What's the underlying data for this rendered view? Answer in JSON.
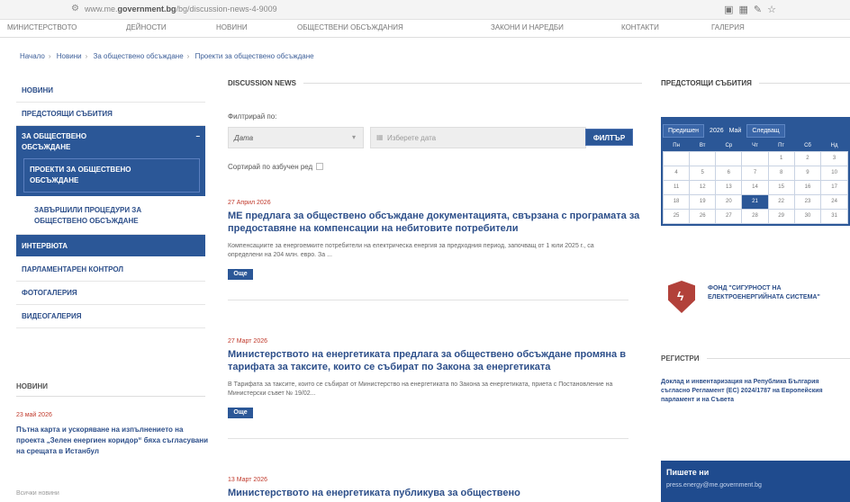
{
  "browser": {
    "url_prefix": "www.me.",
    "url_domain": "government.bg",
    "url_path": "/bg/discussion-news-4-9009"
  },
  "topnav": [
    "МИНИСТЕРСТВОТО",
    "ДЕЙНОСТИ",
    "НОВИНИ",
    "ОБЩЕСТВЕНИ ОБСЪЖДАНИЯ",
    "ЗАКОНИ И НАРЕДБИ",
    "КОНТАКТИ",
    "ГАЛЕРИЯ"
  ],
  "breadcrumbs": [
    "Начало",
    "Новини",
    "За обществено обсъждане",
    "Проекти за обществено обсъждане"
  ],
  "sidebar": {
    "items": [
      "НОВИНИ",
      "ПРЕДСТОЯЩИ СЪБИТИЯ"
    ],
    "open_section": {
      "line1": "ЗА ОБЩЕСТВЕНО",
      "line2": "ОБСЪЖДАНЕ",
      "toggle": "−"
    },
    "sub_active": {
      "line1": "ПРОЕКТИ ЗА ОБЩЕСТВЕНО",
      "line2": "ОБСЪЖДАНЕ"
    },
    "sub_item": {
      "line1": "ЗАВЪРШИЛИ ПРОЦЕДУРИ ЗА",
      "line2": "ОБЩЕСТВЕНО ОБСЪЖДАНЕ"
    },
    "after": [
      "ИНТЕРВЮТА",
      "ПАРЛАМЕНТАРЕН КОНТРОЛ",
      "ФОТОГАЛЕРИЯ",
      "ВИДЕОГАЛЕРИЯ"
    ],
    "news_heading": "НОВИНИ",
    "news_date": "23 май 2026",
    "news_title": "Пътна карта и ускоряване на изпълнението на проекта „Зелен енергиен коридор“ бяха съгласувани на срещата в Истанбул",
    "news_footer": "Всички новини"
  },
  "main": {
    "heading": "DISCUSSION NEWS",
    "filter_label": "Филтрирай по:",
    "select_value": "Дата",
    "date_placeholder": "Изберете дата",
    "filter_button": "ФИЛТЪР",
    "sort_label": "Сортирай по азбучен ред",
    "more_label": "Още",
    "articles": [
      {
        "date": "27 Април 2026",
        "title": "МЕ предлага за обществено обсъждане документацията, свързана с програмата за предоставяне на компенсации на небитовите потребители",
        "excerpt": "Компенсациите за енергоемките потребители на електрическа енергия за предходния период, започващ от 1 юли 2025 г., са определени на 204 млн. евро. За ..."
      },
      {
        "date": "27 Март 2026",
        "title": "Министерството на енергетиката предлага за обществено обсъждане промяна в тарифата за таксите, които се събират по Закона за енергетиката",
        "excerpt": "В Тарифата за таксите, които се събират от Министерство на енергетиката по Закона за енергетиката, приета с Постановление на Министерски съвет № 19/02..."
      },
      {
        "date": "13 Март 2026",
        "title": "Министерството на енергетиката публикува за обществено",
        "excerpt": ""
      }
    ]
  },
  "right": {
    "events_heading": "ПРЕДСТОЯЩИ СЪБИТИЯ",
    "calendar": {
      "prev": "Предишен",
      "year": "2026",
      "month": "Май",
      "next": "Следващ",
      "weekdays": [
        "Пн",
        "Вт",
        "Ср",
        "Чт",
        "Пт",
        "Сб",
        "Нд"
      ],
      "weeks": [
        [
          "",
          "",
          "",
          "",
          "1",
          "2",
          "3"
        ],
        [
          "4",
          "5",
          "6",
          "7",
          "8",
          "9",
          "10"
        ],
        [
          "11",
          "12",
          "13",
          "14",
          "15",
          "16",
          "17"
        ],
        [
          "18",
          "19",
          "20",
          "21",
          "22",
          "23",
          "24"
        ],
        [
          "25",
          "26",
          "27",
          "28",
          "29",
          "30",
          "31"
        ]
      ],
      "today": "21"
    },
    "fund_text": "ФОНД \"СИГУРНОСТ НА ЕЛЕКТРОЕНЕРГИЙНАТА СИСТЕМА\"",
    "registers_heading": "РЕГИСТРИ",
    "registers_text": "Доклад и инвентаризация на Република България съгласно Регламент (ЕС) 2024/1787 на Европейския парламент и на Съвета",
    "write_heading": "Пишете ни",
    "write_email": "press.energy@me.government.bg"
  }
}
